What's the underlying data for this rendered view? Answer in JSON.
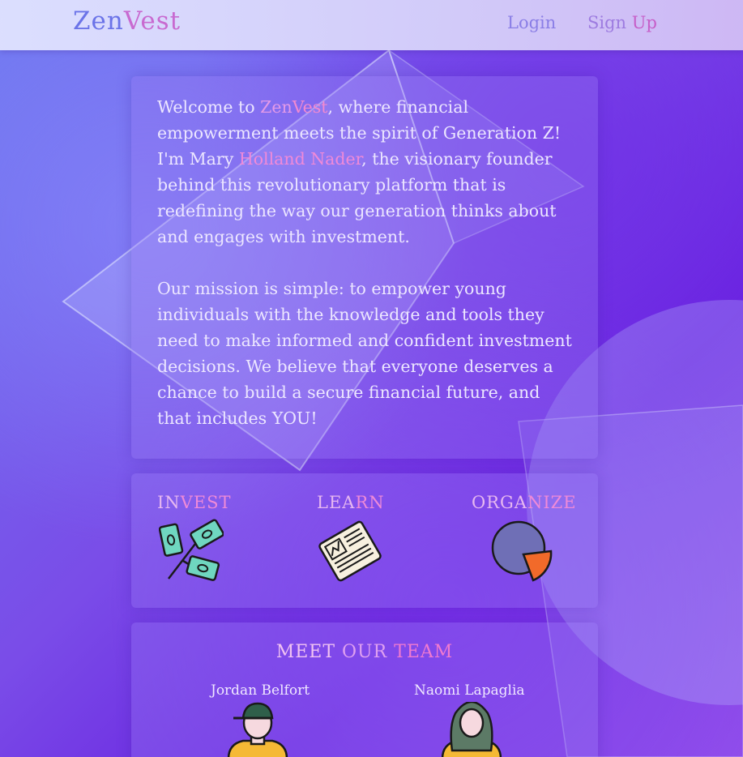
{
  "header": {
    "logo_part1": "Zen",
    "logo_part2": "Vest",
    "login_label": "Login",
    "signup_part1": "Sign ",
    "signup_part2": "Up"
  },
  "intro": {
    "p1_before": "Welcome to ",
    "p1_brand1": "Zen",
    "p1_brand2": "Vest",
    "p1_middle": ", where financial empowerment meets the spirit of Generation Z! I'm Mary ",
    "p1_name": "Holland Nader",
    "p1_after": ", the visionary founder behind this revolutionary platform that is redefining the way our generation thinks about and engages with investment.",
    "p2": "Our mission is simple: to empower young individuals with the knowledge and tools they need to make informed and confident investment decisions. We believe that everyone deserves a chance to build a secure financial future, and that includes YOU!"
  },
  "features": [
    {
      "part1": "IN",
      "part2": "VEST",
      "icon": "money-tree-icon"
    },
    {
      "part1": "LEA",
      "part2": "RN",
      "icon": "newspaper-icon"
    },
    {
      "part1": "ORGA",
      "part2": "NIZE",
      "icon": "pie-chart-icon"
    }
  ],
  "team": {
    "title_w1": "MEET ",
    "title_w2": "OUR ",
    "title_w3": "TEAM",
    "members": [
      {
        "name": "Jordan Belfort",
        "icon": "man-with-cap-icon"
      },
      {
        "name": "Naomi Lapaglia",
        "icon": "woman-with-hijab-icon"
      }
    ]
  },
  "colors": {
    "background": "#6a22e0",
    "header": "#dcdcfa",
    "accent_pink": "#ef8ad8",
    "accent_blue": "#6b73e8"
  }
}
